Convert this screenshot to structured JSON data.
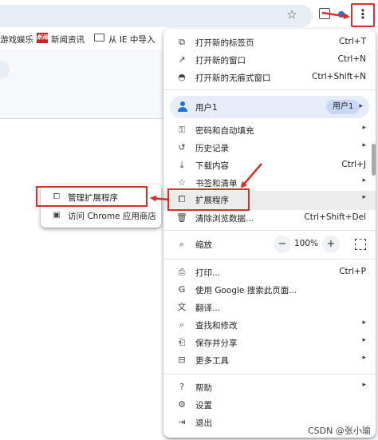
{
  "bookmarks": [
    {
      "label": "游戏娱乐",
      "icon": "none"
    },
    {
      "label": "新闻资讯",
      "icon": "news-logo-icon",
      "logo_text": "新闻"
    },
    {
      "label": "从 IE 中导入",
      "icon": "folder-icon"
    }
  ],
  "toolbar": {
    "star_icon": "star-icon",
    "kebab_icon": "vertical-dots-icon"
  },
  "menu": {
    "new_tab": {
      "label": "打开新的标签页",
      "shortcut": "Ctrl+T"
    },
    "new_window": {
      "label": "打开新的窗口",
      "shortcut": "Ctrl+N"
    },
    "incognito": {
      "label": "打开新的无痕式窗口",
      "shortcut": "Ctrl+Shift+N"
    },
    "profile": {
      "name": "用户1",
      "chip": "用户1"
    },
    "passwords": {
      "label": "密码和自动填充"
    },
    "history": {
      "label": "历史记录"
    },
    "downloads": {
      "label": "下载内容",
      "shortcut": "Ctrl+J"
    },
    "bookmarks": {
      "label": "书签和清单"
    },
    "extensions": {
      "label": "扩展程序"
    },
    "clear_data": {
      "label": "清除浏览数据...",
      "shortcut": "Ctrl+Shift+Del"
    },
    "zoom": {
      "label": "缩放",
      "minus": "−",
      "value": "100%",
      "plus": "+"
    },
    "print": {
      "label": "打印...",
      "shortcut": "Ctrl+P"
    },
    "google_search": {
      "label": "使用 Google 搜索此页面..."
    },
    "translate": {
      "label": "翻译..."
    },
    "find_edit": {
      "label": "查找和修改"
    },
    "save_share": {
      "label": "保存并分享"
    },
    "more_tools": {
      "label": "更多工具"
    },
    "help": {
      "label": "帮助"
    },
    "settings": {
      "label": "设置"
    },
    "exit": {
      "label": "退出"
    }
  },
  "submenu": {
    "manage": {
      "label": "管理扩展程序"
    },
    "store": {
      "label": "访问 Chrome 应用商店"
    }
  },
  "watermark": "CSDN @张小瑜",
  "colors": {
    "highlight_red": "#d93025",
    "accent_blue": "#1a73e8"
  }
}
